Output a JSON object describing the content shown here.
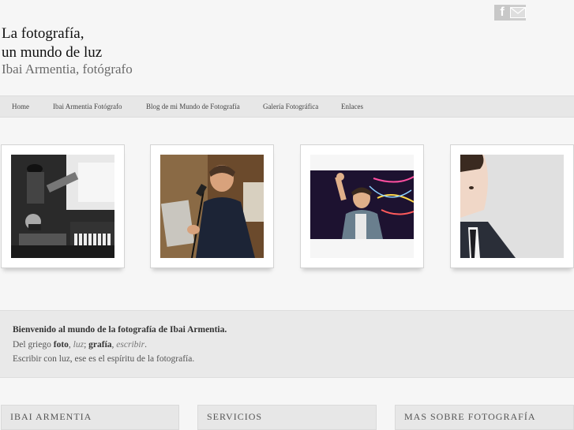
{
  "header": {
    "title_line1": "La fotografía,",
    "title_line2": "un mundo de luz",
    "subtitle": "Ibai Armentia, fotógrafo"
  },
  "social": {
    "facebook_glyph": "f"
  },
  "nav": {
    "items": [
      "Home",
      "Ibai Armentia Fotógrafo",
      "Blog de mi Mundo de Fotografía",
      "Galería Fotográfica",
      "Enlaces"
    ]
  },
  "welcome": {
    "line1": "Bienvenido al mundo de la fotografía de Ibai Armentia.",
    "line2_prefix": "Del griego ",
    "line2_foto": "foto",
    "line2_sep1": ", ",
    "line2_luz": "luz",
    "line2_sep2": "; ",
    "line2_grafia": "grafía",
    "line2_sep3": ", ",
    "line2_escribir": "escribir",
    "line2_end": ".",
    "line3": "Escribir con luz, ese es el espíritu de la fotografía."
  },
  "boxes": {
    "titles": [
      "IBAI ARMENTIA",
      "SERVICIOS",
      "MAS SOBRE FOTOGRAFÍA"
    ]
  },
  "colors": {
    "background": "#f6f6f6",
    "nav_bar": "#e7e7e7",
    "welcome_band": "#e9e9e9"
  },
  "icons": {
    "facebook": "facebook-icon",
    "mail": "mail-icon"
  }
}
